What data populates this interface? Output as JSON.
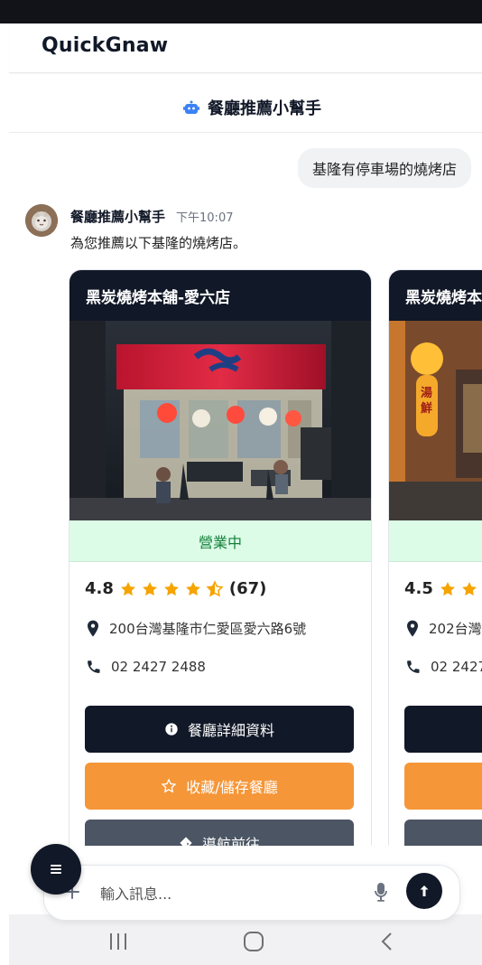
{
  "app": {
    "title": "QuickGnaw"
  },
  "assistant": {
    "name": "餐廳推薦小幫手"
  },
  "conversation": {
    "user_message": "基隆有停車場的燒烤店",
    "bot_name": "餐廳推薦小幫手",
    "bot_time": "下午10:07",
    "bot_text": "為您推薦以下基隆的燒烤店。"
  },
  "cards": [
    {
      "title": "黑炭燒烤本舖-愛六店",
      "status": "營業中",
      "rating": "4.8",
      "stars": 4.5,
      "reviews": "(67)",
      "address": "200台灣基隆市仁愛區愛六路6號",
      "phone": "02 2427 2488",
      "buttons": {
        "details": "餐廳詳細資料",
        "save": "收藏/儲存餐廳",
        "navigate": "導航前往"
      }
    },
    {
      "title": "黑炭燒烤本",
      "rating": "4.5",
      "address": "202台灣",
      "phone": "02 2427"
    }
  ],
  "composer": {
    "placeholder": "輸入訊息..."
  },
  "icons": {
    "robot": "robot-icon",
    "star": "star-icon",
    "half_star": "half-star-icon",
    "location": "location-pin-icon",
    "phone": "phone-icon",
    "info": "info-icon",
    "star_outline": "star-outline-icon",
    "navigate": "navigation-icon",
    "menu": "menu-icon",
    "plus": "plus-icon",
    "mic": "mic-icon",
    "send": "send-icon"
  },
  "colors": {
    "dark": "#111827",
    "orange": "#f59638",
    "green": "#16803c",
    "green_bg": "#dcfce7",
    "star": "#f5a400",
    "gray_button": "#4b5563"
  }
}
